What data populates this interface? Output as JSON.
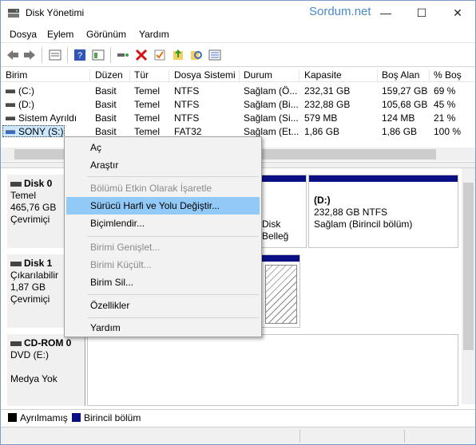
{
  "window": {
    "title": "Disk Yönetimi",
    "watermark": "Sordum.net",
    "minimize_glyph": "—",
    "maximize_glyph": "☐",
    "close_glyph": "✕"
  },
  "menu": {
    "items": [
      "Dosya",
      "Eylem",
      "Görünüm",
      "Yardım"
    ]
  },
  "toolbar": {
    "icons": [
      "back-icon",
      "forward-icon",
      "properties-icon",
      "help-icon",
      "console-icon",
      "connect-icon",
      "delete-icon",
      "check-icon",
      "up-icon",
      "search-icon",
      "view-icon"
    ]
  },
  "volumes": {
    "headers": [
      "Birim",
      "Düzen",
      "Tür",
      "Dosya Sistemi",
      "Durum",
      "Kapasite",
      "Boş Alan",
      "% Boş"
    ],
    "rows": [
      [
        "(C:)",
        "Basit",
        "Temel",
        "NTFS",
        "Sağlam (Ö...",
        "232,31 GB",
        "159,27 GB",
        "69 %"
      ],
      [
        "(D:)",
        "Basit",
        "Temel",
        "NTFS",
        "Sağlam (Bi...",
        "232,88 GB",
        "105,68 GB",
        "45 %"
      ],
      [
        "Sistem Ayrıldı",
        "Basit",
        "Temel",
        "NTFS",
        "Sağlam (Si...",
        "579 MB",
        "124 MB",
        "21 %"
      ],
      [
        "SONY (S:)",
        "Basit",
        "Temel",
        "FAT32",
        "Sağlam (Et...",
        "1,86 GB",
        "1,86 GB",
        "100 %"
      ]
    ]
  },
  "disks": [
    {
      "name": "Disk 0",
      "type": "Temel",
      "size": "465,76 GB",
      "status": "Çevrimiçi"
    },
    {
      "name": "Disk 1",
      "type": "Çıkarılabilir",
      "size": "1,87 GB",
      "status": "Çevrimiçi"
    },
    {
      "name": "CD-ROM 0",
      "type": "DVD (E:)",
      "size": "",
      "status": "Medya Yok"
    }
  ],
  "partitions": {
    "d_name": "(D:)",
    "d_size": "232,88 GB NTFS",
    "d_status": "Sağlam (Birincil bölüm)",
    "c_partial": "Disk Belleğ"
  },
  "legend": {
    "unallocated": "Ayrılmamış",
    "primary": "Birincil bölüm",
    "colors": {
      "unallocated": "#000000",
      "primary": "#0a0f84"
    }
  },
  "context_menu": {
    "items": [
      {
        "label": "Aç",
        "disabled": false
      },
      {
        "label": "Araştır",
        "disabled": false
      },
      {
        "label": "Bölümü Etkin Olarak İşaretle",
        "disabled": true
      },
      {
        "label": "Sürücü Harfi ve Yolu Değiştir...",
        "disabled": false,
        "highlighted": true
      },
      {
        "label": "Biçimlendir...",
        "disabled": false
      },
      {
        "label": "Birimi Genişlet...",
        "disabled": true
      },
      {
        "label": "Birimi Küçült...",
        "disabled": true
      },
      {
        "label": "Birim Sil...",
        "disabled": false
      },
      {
        "label": "Özellikler",
        "disabled": false
      },
      {
        "label": "Yardım",
        "disabled": false
      }
    ]
  }
}
